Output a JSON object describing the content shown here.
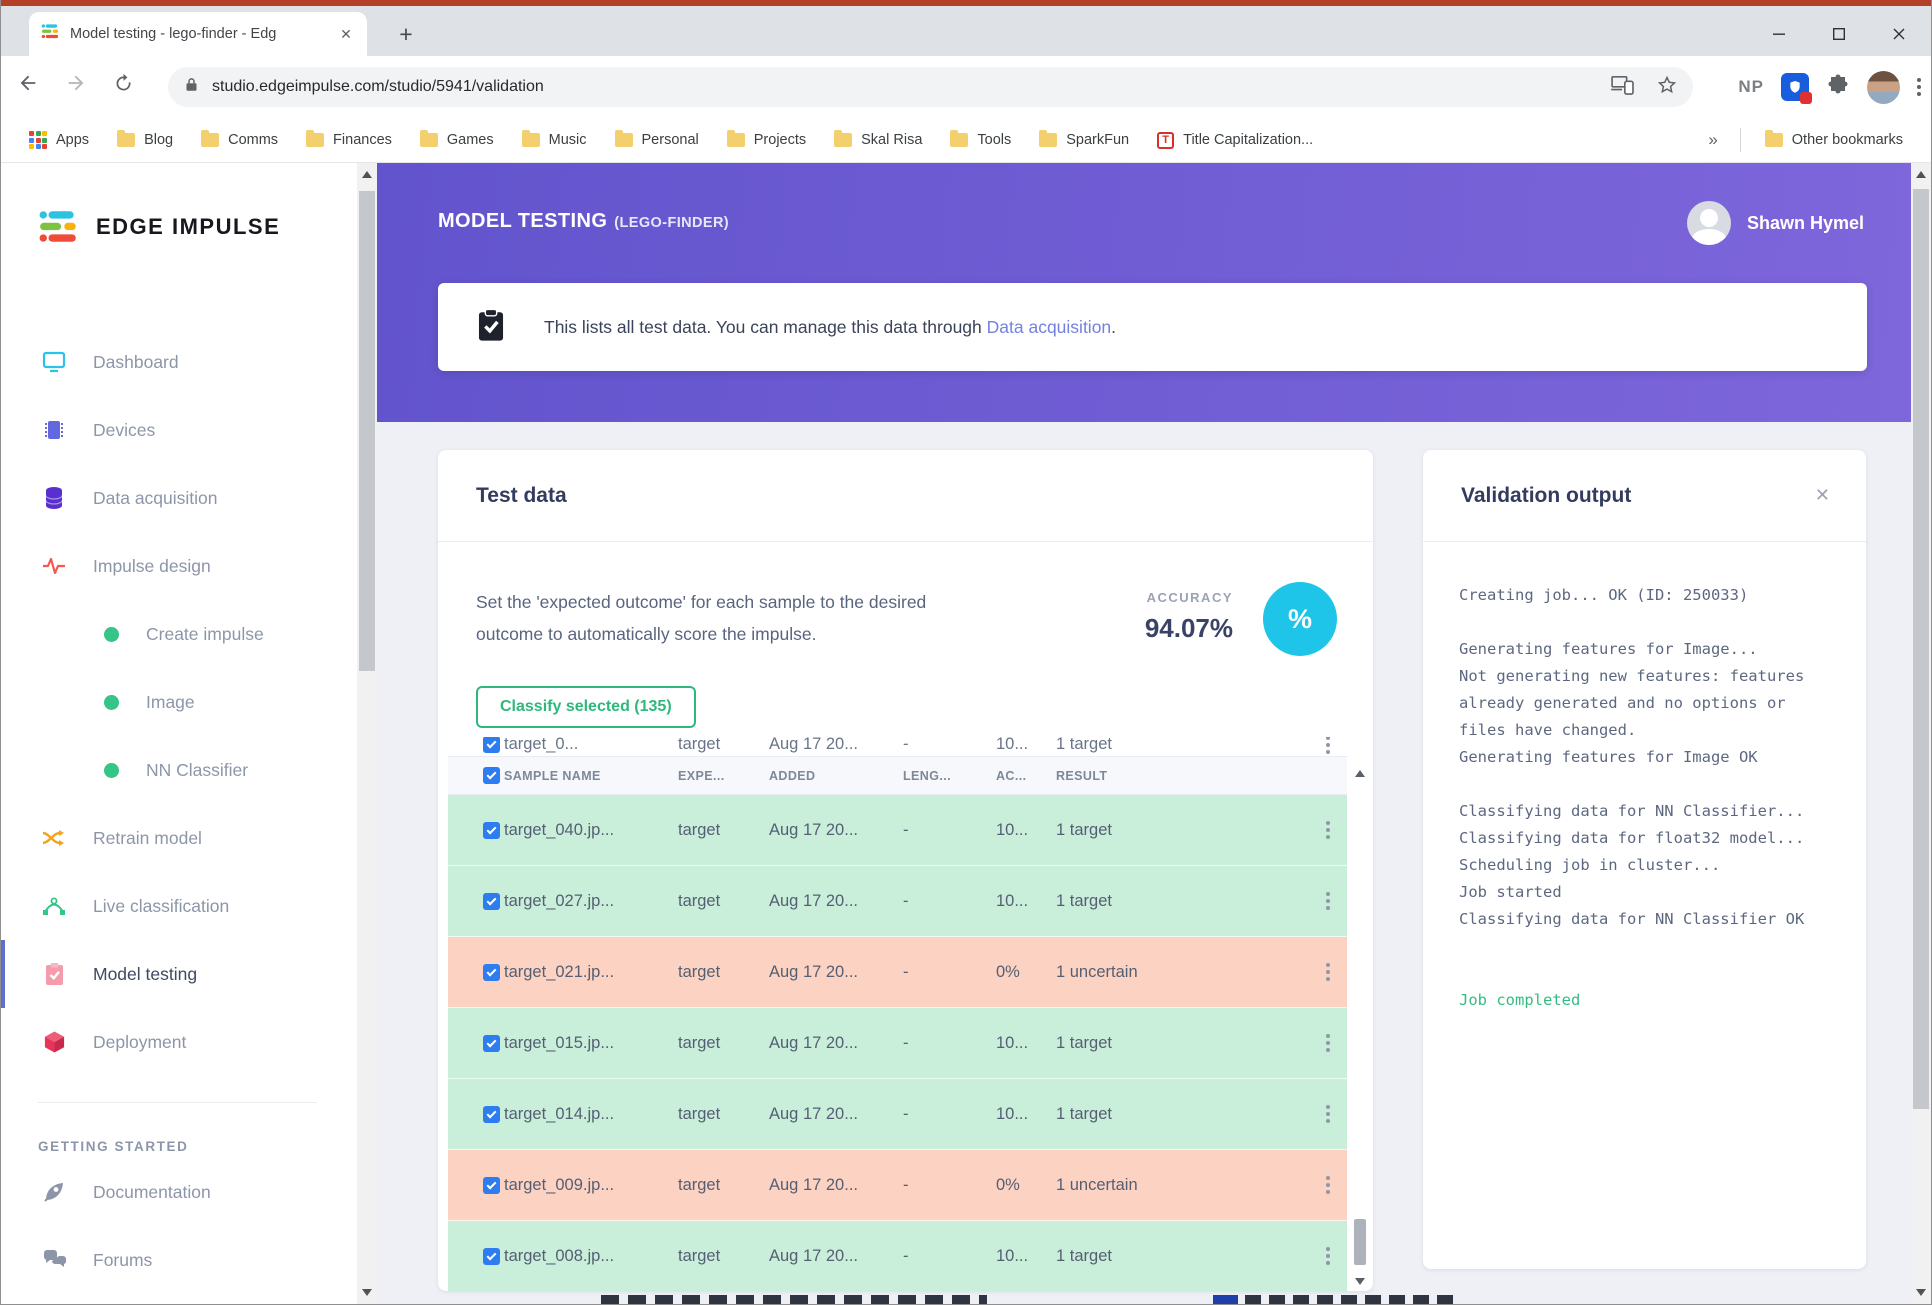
{
  "browser": {
    "tab_title": "Model testing - lego-finder - Edg",
    "url": "studio.edgeimpulse.com/studio/5941/validation",
    "profile_badge": "NP",
    "apps_label": "Apps",
    "bookmark_folders": [
      "Blog",
      "Comms",
      "Finances",
      "Games",
      "Music",
      "Personal",
      "Projects",
      "Skal Risa",
      "Tools",
      "SparkFun"
    ],
    "titlecap_label": "Title Capitalization...",
    "overflow_chevron": "»",
    "other_bookmarks": "Other bookmarks"
  },
  "sidebar": {
    "logo_text": "EDGE IMPULSE",
    "items": [
      {
        "label": "Dashboard"
      },
      {
        "label": "Devices"
      },
      {
        "label": "Data acquisition"
      },
      {
        "label": "Impulse design"
      },
      {
        "label": "Create impulse"
      },
      {
        "label": "Image"
      },
      {
        "label": "NN Classifier"
      },
      {
        "label": "Retrain model"
      },
      {
        "label": "Live classification"
      },
      {
        "label": "Model testing"
      },
      {
        "label": "Deployment"
      }
    ],
    "section_label": "GETTING STARTED",
    "secondary_items": [
      {
        "label": "Documentation"
      },
      {
        "label": "Forums"
      }
    ]
  },
  "header": {
    "title": "MODEL TESTING",
    "subtitle": "(LEGO-FINDER)",
    "user_name": "Shawn Hymel"
  },
  "banner": {
    "text_before": "This lists all test data. You can manage this data through ",
    "link": "Data acquisition",
    "text_after": "."
  },
  "test_data": {
    "title": "Test data",
    "description": "Set the 'expected outcome' for each sample to the desired outcome to automatically score the impulse.",
    "accuracy_label": "ACCURACY",
    "accuracy_value": "94.07%",
    "percent_symbol": "%",
    "classify_button": "Classify selected (135)",
    "columns": [
      "SAMPLE NAME",
      "EXPE...",
      "ADDED",
      "LENG...",
      "AC...",
      "RESULT"
    ],
    "clipped_row": {
      "name": "target_0...",
      "expected": "target",
      "added": "Aug 17 20...",
      "length": "-",
      "accuracy": "10...",
      "result": "1 target"
    },
    "rows": [
      {
        "name": "target_040.jp...",
        "expected": "target",
        "added": "Aug 17 20...",
        "length": "-",
        "accuracy": "10...",
        "result": "1 target",
        "status": "pass"
      },
      {
        "name": "target_027.jp...",
        "expected": "target",
        "added": "Aug 17 20...",
        "length": "-",
        "accuracy": "10...",
        "result": "1 target",
        "status": "pass"
      },
      {
        "name": "target_021.jp...",
        "expected": "target",
        "added": "Aug 17 20...",
        "length": "-",
        "accuracy": "0%",
        "result": "1 uncertain",
        "status": "fail"
      },
      {
        "name": "target_015.jp...",
        "expected": "target",
        "added": "Aug 17 20...",
        "length": "-",
        "accuracy": "10...",
        "result": "1 target",
        "status": "pass"
      },
      {
        "name": "target_014.jp...",
        "expected": "target",
        "added": "Aug 17 20...",
        "length": "-",
        "accuracy": "10...",
        "result": "1 target",
        "status": "pass"
      },
      {
        "name": "target_009.jp...",
        "expected": "target",
        "added": "Aug 17 20...",
        "length": "-",
        "accuracy": "0%",
        "result": "1 uncertain",
        "status": "fail"
      },
      {
        "name": "target_008.jp...",
        "expected": "target",
        "added": "Aug 17 20...",
        "length": "-",
        "accuracy": "10...",
        "result": "1 target",
        "status": "pass"
      }
    ]
  },
  "validation": {
    "title": "Validation output",
    "console_lines": [
      "Creating job... OK (ID: 250033)",
      "",
      "Generating features for Image...",
      "Not generating new features: features",
      "already generated and no options or",
      "files have changed.",
      "Generating features for Image OK",
      "",
      "Classifying data for NN Classifier...",
      "Classifying data for float32 model...",
      "Scheduling job in cluster...",
      "Job started",
      "Classifying data for NN Classifier OK",
      "",
      ""
    ],
    "job_completed": "Job completed"
  }
}
